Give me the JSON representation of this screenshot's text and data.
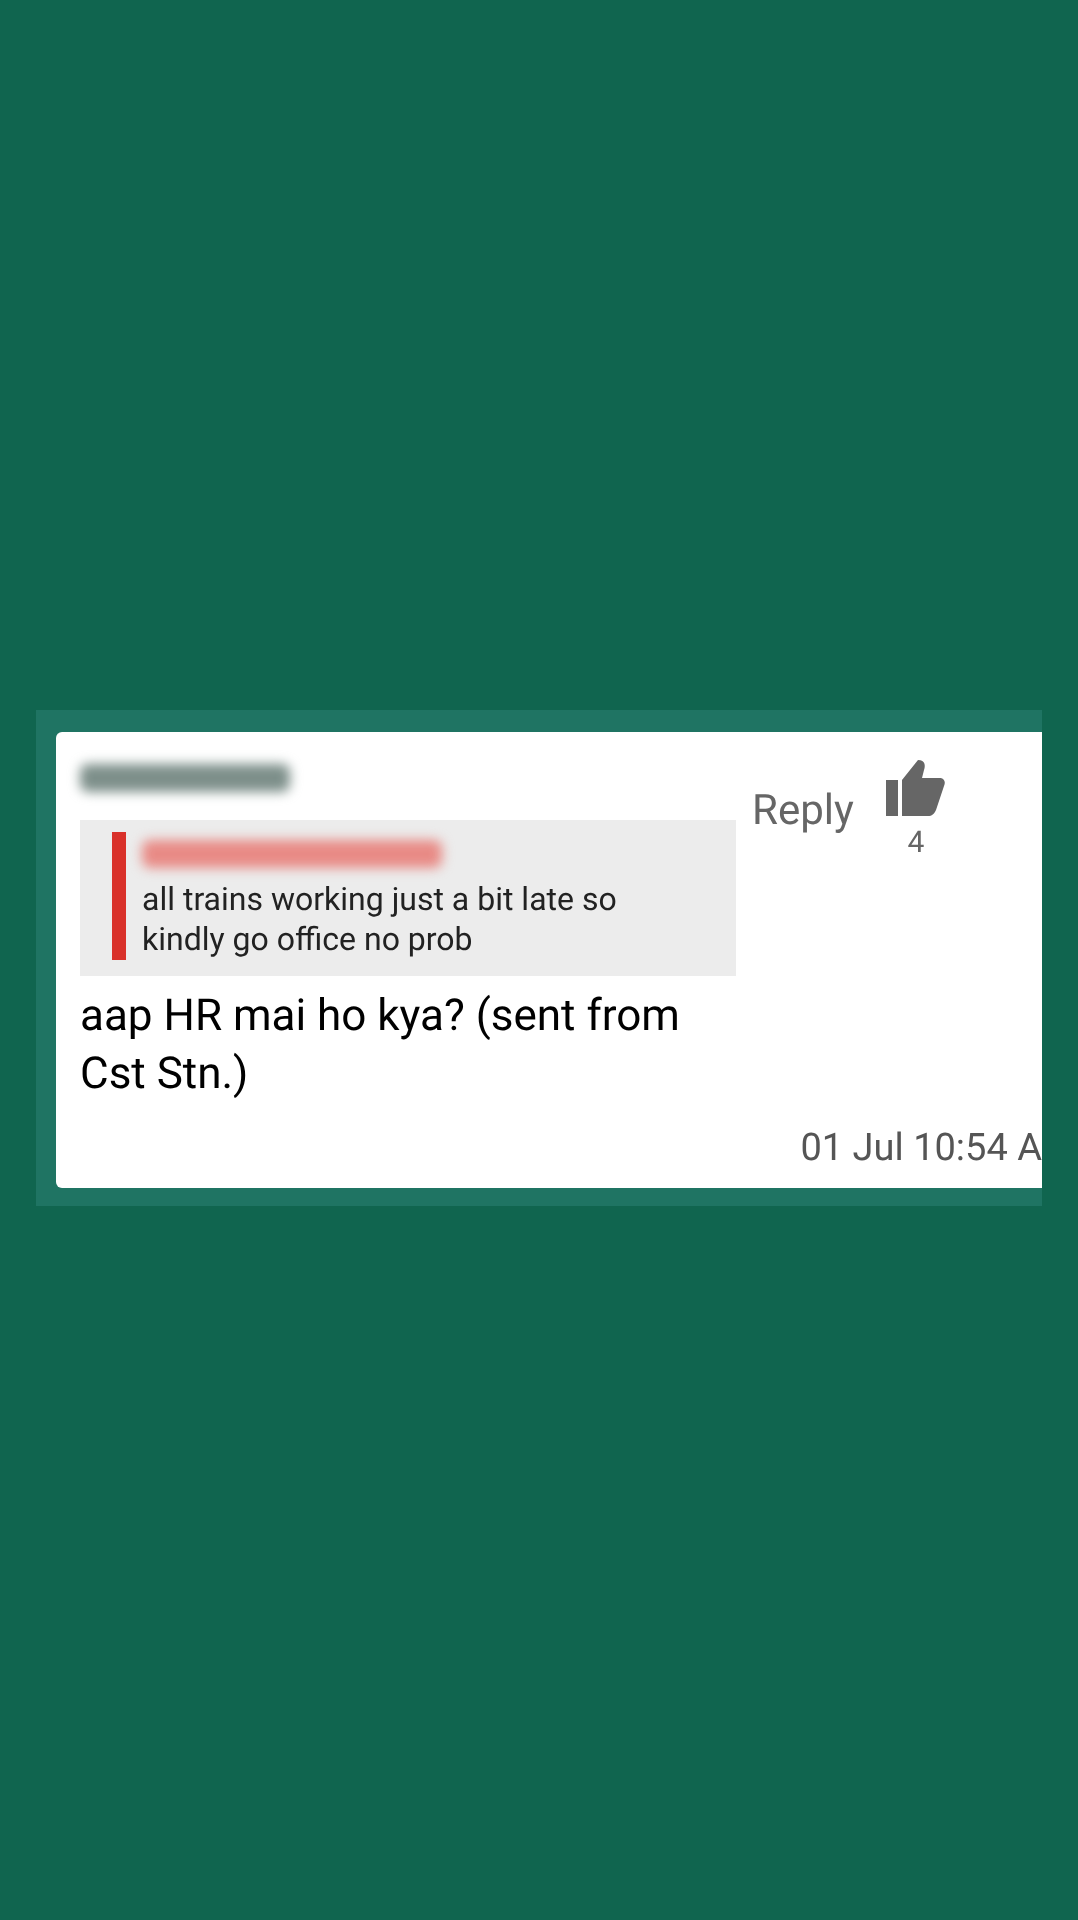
{
  "comment": {
    "author_redacted": true,
    "quote": {
      "author_redacted": true,
      "text": "all trains working just a bit late so kindly go office no prob"
    },
    "body": "aap HR mai ho kya? (sent from Cst Stn.)",
    "reply_label": "Reply",
    "like_count": "4",
    "timestamp": "01 Jul 10:54 A"
  }
}
